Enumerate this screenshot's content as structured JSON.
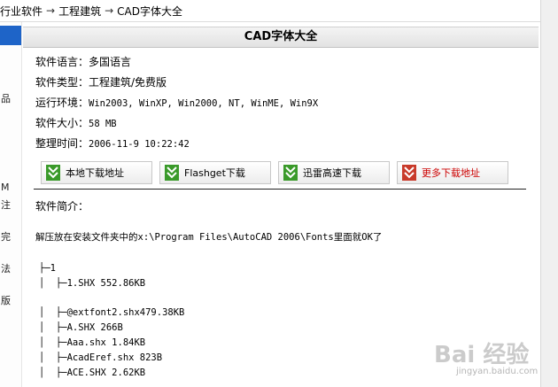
{
  "breadcrumb": {
    "items": [
      "行业软件",
      "工程建筑",
      "CAD字体大全"
    ],
    "separator": "→"
  },
  "sidebar": {
    "fragments": [
      "品",
      "M",
      "注",
      "完",
      "法",
      "版"
    ]
  },
  "title": "CAD字体大全",
  "info": [
    {
      "label": "软件语言：",
      "value": "多国语言"
    },
    {
      "label": "软件类型：",
      "value": "工程建筑/免费版"
    },
    {
      "label": "运行环境：",
      "value": "Win2003, WinXP, Win2000, NT, WinME, Win9X"
    },
    {
      "label": "软件大小：",
      "value": "58 MB"
    },
    {
      "label": "整理时间：",
      "value": "2006-11-9 10:22:42"
    }
  ],
  "downloads": [
    {
      "label": "本地下载地址"
    },
    {
      "label": "Flashget下载"
    },
    {
      "label": "迅雷高速下载"
    },
    {
      "label": "更多下载地址"
    }
  ],
  "intro_label": "软件简介：",
  "description": "解压放在安装文件夹中的x:\\Program Files\\AutoCAD 2006\\Fonts里面就OK了",
  "tree": [
    "├─1",
    "│  ├─1.SHX 552.86KB",
    "",
    "│  ├─@extfont2.shx479.38KB",
    "│  ├─A.SHX 266B",
    "│  ├─Aaa.shx 1.84KB",
    "│  ├─AcadEref.shx 823B",
    "│  ├─ACE.SHX 2.62KB"
  ],
  "watermark": {
    "text": "Bai 经验",
    "sub": "jingyan.baidu.com"
  },
  "colors": {
    "accent": "#1e64c8",
    "more_link": "#cc0000",
    "icon_green": "#3a9a2a"
  }
}
